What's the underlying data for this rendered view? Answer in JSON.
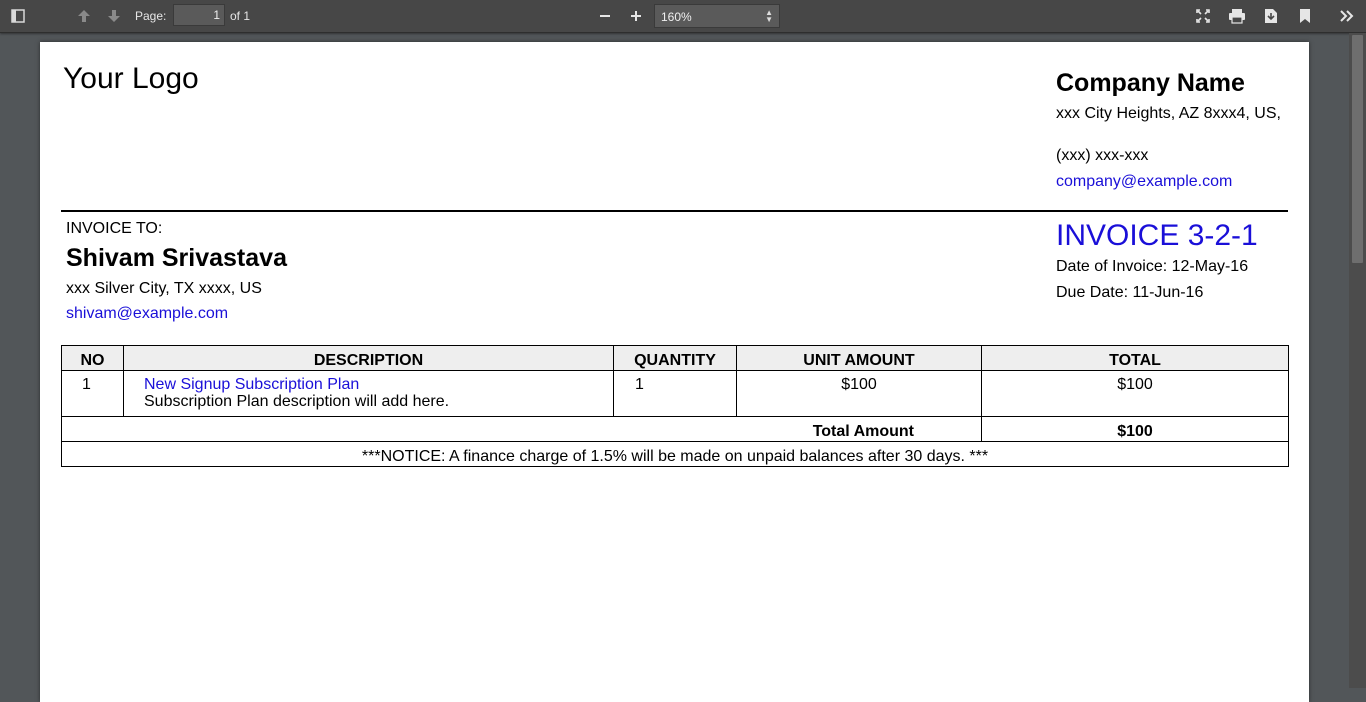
{
  "toolbar": {
    "page_label": "Page:",
    "page_value": "1",
    "page_count": "of 1",
    "zoom": "160%"
  },
  "invoice": {
    "logo_text": "Your Logo",
    "company": {
      "name": "Company Name",
      "address": "xxx City Heights, AZ 8xxx4, US,",
      "phone": "(xxx) xxx-xxx",
      "email": "company@example.com"
    },
    "bill_to": {
      "label": "INVOICE TO:",
      "name": "Shivam Srivastava",
      "address": "xxx Silver City, TX xxxx, US",
      "email": "shivam@example.com"
    },
    "number": "INVOICE 3-2-1",
    "date_of_invoice": "Date of Invoice: 12-May-16",
    "due_date": "Due Date: 11-Jun-16",
    "table": {
      "headers": [
        "NO",
        "DESCRIPTION",
        "QUANTITY",
        "UNIT AMOUNT",
        "TOTAL"
      ],
      "rows": [
        {
          "no": "1",
          "title": "New Signup Subscription Plan",
          "description": "Subscription Plan description will add here.",
          "quantity": "1",
          "unit_amount": "$100",
          "total": "$100"
        }
      ],
      "total_label": "Total Amount",
      "total_value": "$100",
      "notice": "***NOTICE: A finance charge of 1.5% will be made on unpaid balances after 30 days. ***"
    }
  },
  "colors": {
    "link": "#1a0fd8",
    "toolbar": "#474747",
    "viewer_bg": "#525659"
  }
}
